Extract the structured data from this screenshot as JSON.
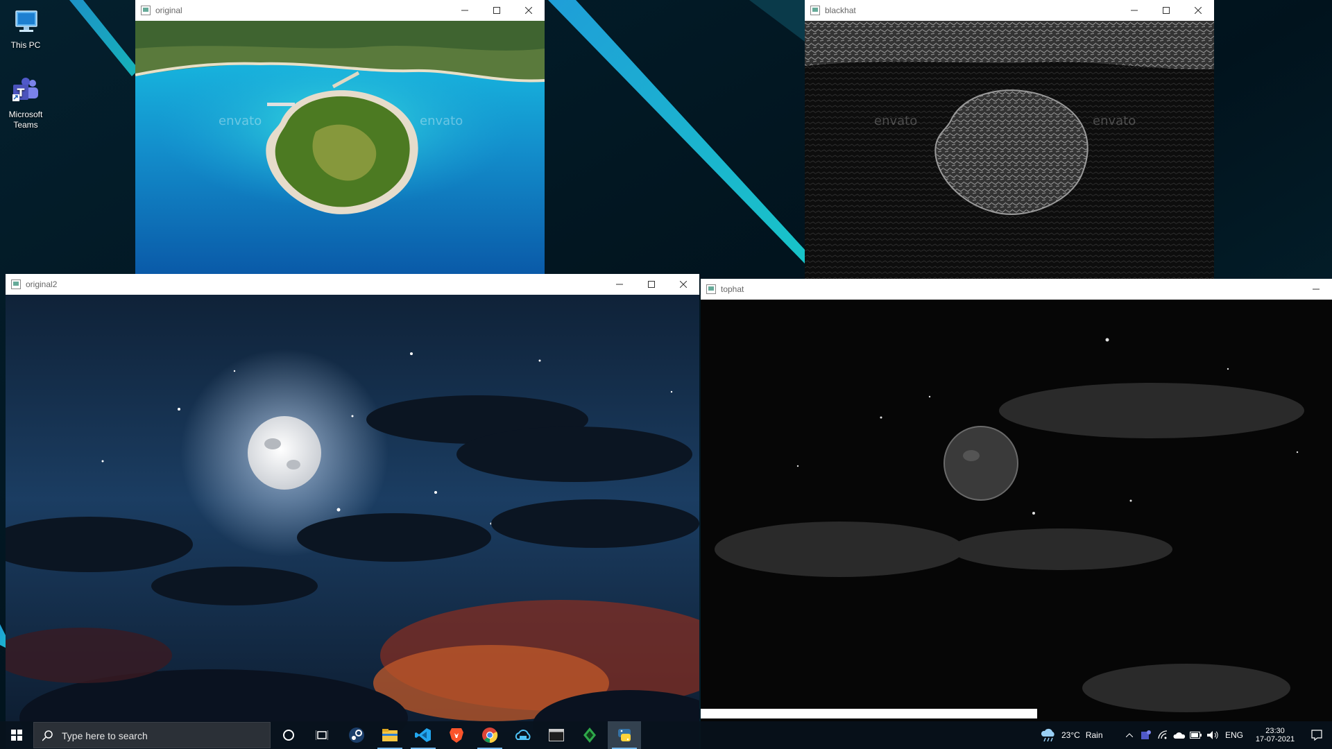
{
  "desktop": {
    "icons": [
      {
        "label": "This PC",
        "icon": "this-pc-icon"
      },
      {
        "label": "Microsoft Teams",
        "label_line1": "Microsoft",
        "label_line2": "Teams",
        "icon": "teams-icon"
      }
    ]
  },
  "windows": [
    {
      "id": "original",
      "title": "original",
      "content": "aerial-island-photo",
      "watermark": "envato"
    },
    {
      "id": "blackhat",
      "title": "blackhat",
      "content": "blackhat-filtered-island",
      "watermark": "envato"
    },
    {
      "id": "original2",
      "title": "original2",
      "content": "night-sky-moon-photo"
    },
    {
      "id": "tophat",
      "title": "tophat",
      "content": "tophat-filtered-night-sky"
    }
  ],
  "taskbar": {
    "search_placeholder": "Type here to search",
    "apps": [
      "cortana-icon",
      "task-view-icon",
      "steam-icon",
      "file-explorer-icon",
      "vscode-icon",
      "brave-icon",
      "chrome-icon",
      "onedrive-app-icon",
      "terminal-icon",
      "app-icon",
      "python-icon"
    ],
    "weather": {
      "temp": "23°C",
      "condition": "Rain"
    },
    "language": "ENG",
    "clock": {
      "time": "23:30",
      "date": "17-07-2021"
    }
  },
  "colors": {
    "accent": "#76b9ed",
    "sea": "#18a8d8",
    "night": "#132b47"
  }
}
